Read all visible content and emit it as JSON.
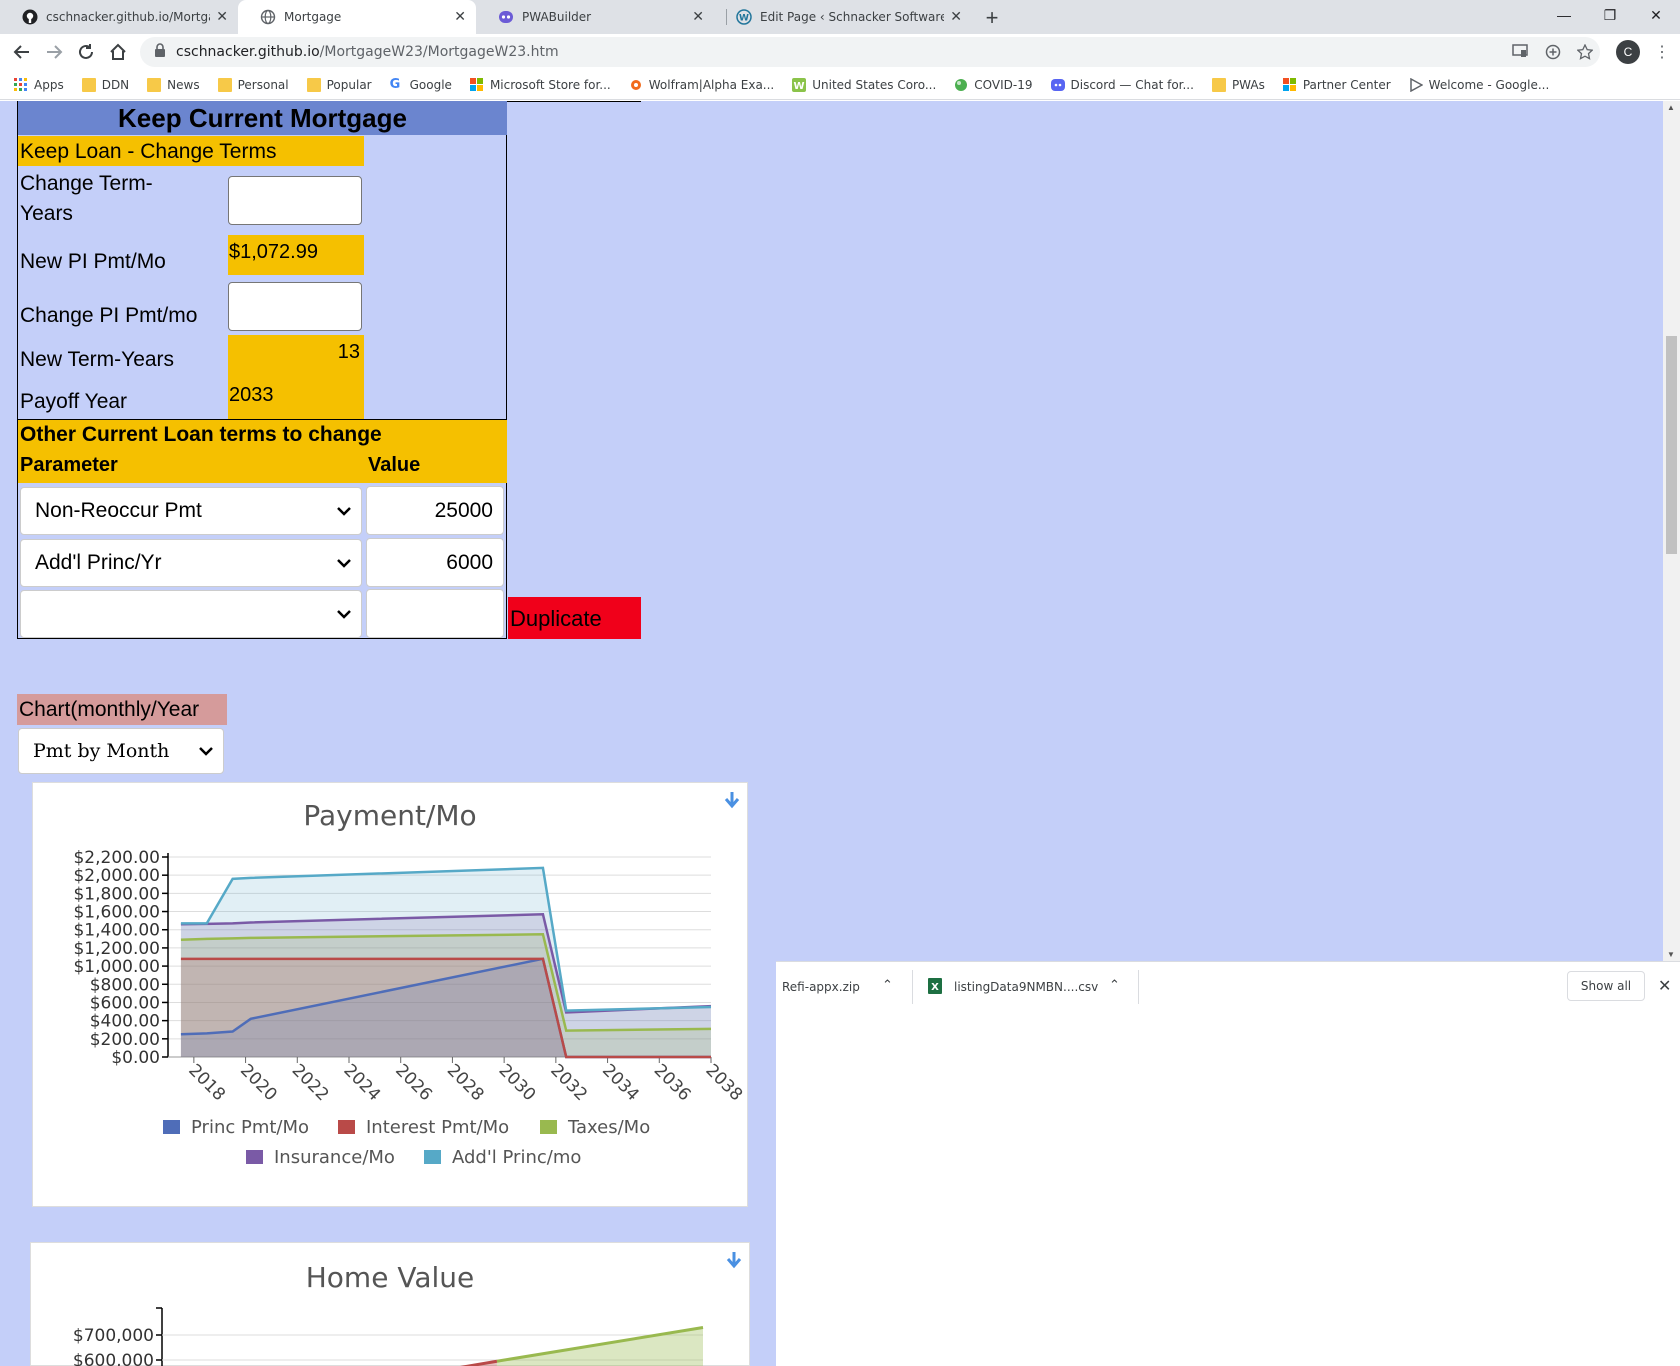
{
  "browser": {
    "tabs": [
      {
        "title": "cschnacker.github.io/MortgageW",
        "icon": "github-icon"
      },
      {
        "title": "Mortgage",
        "icon": "globe-icon"
      },
      {
        "title": "PWABuilder",
        "icon": "pwabuilder-icon"
      },
      {
        "title": "Edit Page ‹ Schnacker Software S",
        "icon": "wordpress-icon"
      }
    ],
    "url_host": "cschnacker.github.io",
    "url_path": "/MortgageW23/MortgageW23.htm",
    "profile_initial": "C",
    "bookmarks": [
      "Apps",
      "DDN",
      "News",
      "Personal",
      "Popular",
      "Google",
      "Microsoft Store for...",
      "Wolfram|Alpha Exa...",
      "United States Coro...",
      "COVID-19",
      "Discord — Chat for...",
      "PWAs",
      "Partner Center",
      "Welcome - Google..."
    ]
  },
  "panel": {
    "title": "Keep Current Mortgage",
    "section_header": "Keep Loan - Change Terms",
    "change_term_label": "Change Term-\nYears",
    "change_term_label_1": "Change Term-",
    "change_term_label_2": "Years",
    "new_pi_label": "New PI Pmt/Mo",
    "new_pi_value": "$1,072.99",
    "change_pi_label": "Change PI Pmt/mo",
    "new_term_label": "New Term-Years",
    "new_term_value": "13",
    "payoff_label": "Payoff Year",
    "payoff_value": "2033",
    "other_header": "Other Current Loan  terms to change",
    "param_header": "Parameter",
    "value_header": "Value",
    "rows": [
      {
        "param": "Non-Reoccur Pmt",
        "value": "25000"
      },
      {
        "param": "Add'l Princ/Yr",
        "value": "6000"
      },
      {
        "param": "",
        "value": ""
      }
    ],
    "duplicate_label": "Duplicate"
  },
  "chart_controls": {
    "label": "Chart(monthly/Year",
    "selected": "Pmt by Month"
  },
  "chart_data": [
    {
      "type": "area",
      "title": "Payment/Mo",
      "x": [
        2017.5,
        2018.5,
        2019.5,
        2020.2,
        2031.5,
        2032.4,
        2038
      ],
      "series": [
        {
          "name": "Princ Pmt/Mo",
          "color": "#4f6db8",
          "values": [
            250,
            260,
            280,
            420,
            1080,
            0,
            0
          ]
        },
        {
          "name": "Interest Pmt/Mo",
          "color": "#b94a48",
          "values": [
            1080,
            1080,
            1080,
            1080,
            1080,
            0,
            0
          ]
        },
        {
          "name": "Taxes/Mo",
          "color": "#99b94f",
          "values": [
            1290,
            1300,
            1305,
            1310,
            1350,
            290,
            310
          ]
        },
        {
          "name": "Insurance/Mo",
          "color": "#7a5aa6",
          "values": [
            1460,
            1465,
            1470,
            1480,
            1570,
            490,
            560
          ]
        },
        {
          "name": "Add'l Princ/mo",
          "color": "#56a9c7",
          "values": [
            1470,
            1470,
            1960,
            1970,
            2080,
            510,
            550
          ]
        }
      ],
      "ylim": [
        0,
        2200
      ],
      "yticks": [
        "$0.00",
        "$200.00",
        "$400.00",
        "$600.00",
        "$800.00",
        "$1,000.00",
        "$1,200.00",
        "$1,400.00",
        "$1,600.00",
        "$1,800.00",
        "$2,000.00",
        "$2,200.00"
      ],
      "xticks": [
        "2018",
        "2020",
        "2022",
        "2024",
        "2026",
        "2028",
        "2030",
        "2032",
        "2034",
        "2036",
        "2038"
      ],
      "xlim": [
        2017,
        2038
      ],
      "legend": "bottom"
    },
    {
      "type": "area",
      "title": "Home Value",
      "ylim": [
        500000,
        750000
      ],
      "yticks": [
        "$600,000",
        "$700,000"
      ],
      "series": [
        {
          "name": "",
          "color": "#99b94f",
          "x": [
            2030,
            2038
          ],
          "values": [
            595000,
            730000
          ]
        },
        {
          "name": "",
          "color": "#b94a48",
          "x": [
            2028,
            2030
          ],
          "values": [
            560000,
            595000
          ]
        }
      ]
    }
  ],
  "downloads": [
    {
      "name": "Refi-appx.zip",
      "icon": "zip-file-icon"
    },
    {
      "name": "listingData9NMBN....csv",
      "icon": "excel-file-icon"
    }
  ],
  "downloads_show_all": "Show all"
}
